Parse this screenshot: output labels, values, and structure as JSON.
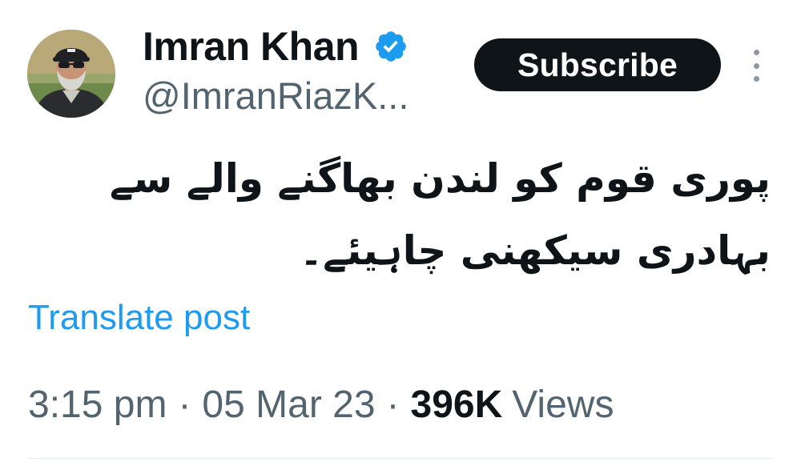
{
  "author": {
    "display_name": "Imran Khan",
    "handle": "@ImranRiazK...",
    "verified": true,
    "verified_color": "#1d9bf0"
  },
  "actions": {
    "subscribe_label": "Subscribe",
    "more_icon": "more-vertical-icon"
  },
  "post": {
    "text": "پوری قوم کو لندن بھاگنے والے سے بہادری سیکھنی چاہیئے۔",
    "translate_label": "Translate post"
  },
  "meta": {
    "time": "3:15 pm",
    "separator": "·",
    "date": "05 Mar 23",
    "views_count": "396K",
    "views_label": "Views"
  },
  "colors": {
    "text_primary": "#0f1419",
    "text_secondary": "#536471",
    "link": "#1d9bf0",
    "button_bg": "#0f1419"
  }
}
